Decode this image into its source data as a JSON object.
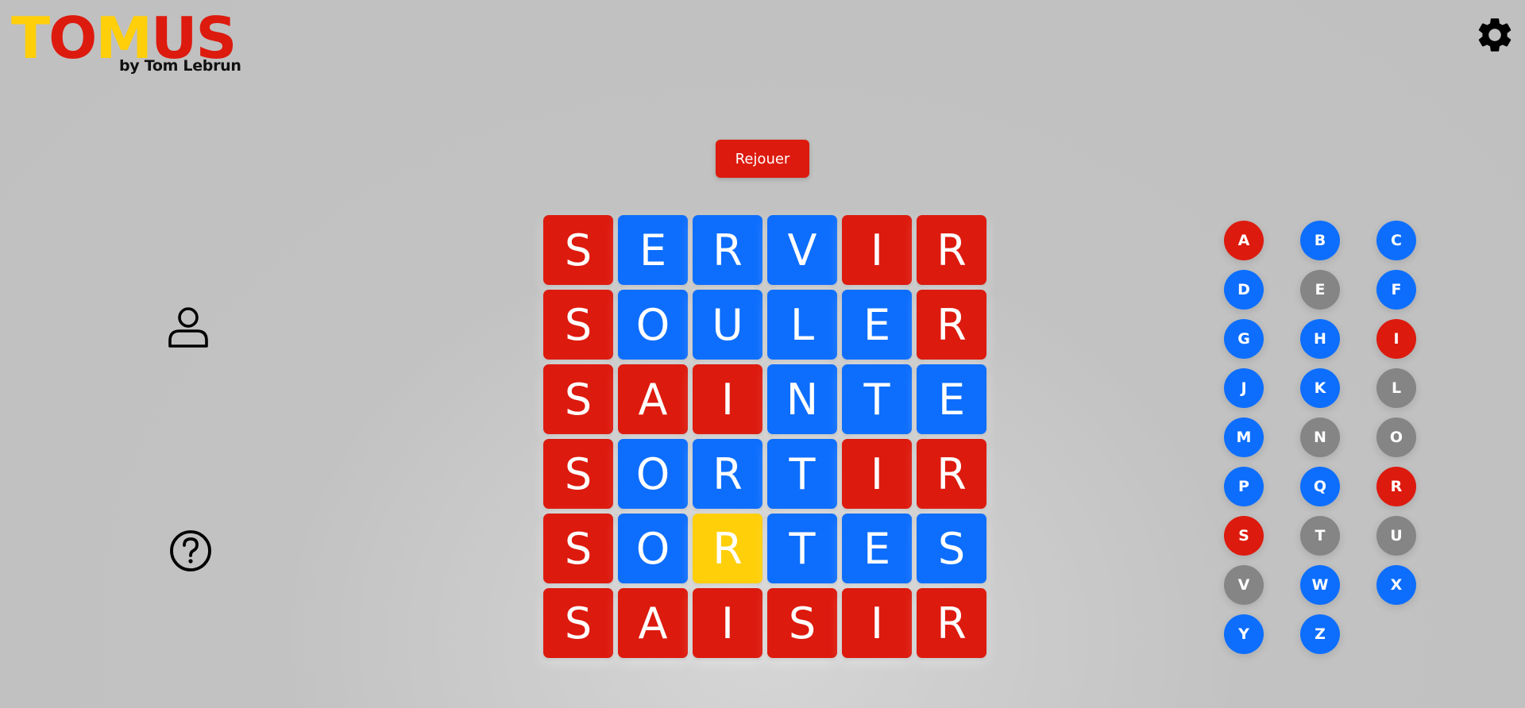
{
  "app": {
    "logo_letters": [
      {
        "char": "T",
        "color": "#ffcf0a"
      },
      {
        "char": "O",
        "color": "#dd1a0e"
      },
      {
        "char": "M",
        "color": "#ffcf0a"
      },
      {
        "char": "U",
        "color": "#dd1a0e"
      },
      {
        "char": "S",
        "color": "#dd1a0e"
      }
    ],
    "byline": "by Tom Lebrun"
  },
  "icons": {
    "settings": "gear-icon",
    "profile": "user-icon",
    "help": "help-icon"
  },
  "replay_label": "Rejouer",
  "colors": {
    "correct": "#dd1a0e",
    "misplaced": "#ffcf0a",
    "absent": "#0d6efd",
    "unused_key": "#858585"
  },
  "grid": {
    "rows": [
      [
        {
          "letter": "S",
          "state": "correct"
        },
        {
          "letter": "E",
          "state": "absent"
        },
        {
          "letter": "R",
          "state": "absent"
        },
        {
          "letter": "V",
          "state": "absent"
        },
        {
          "letter": "I",
          "state": "correct"
        },
        {
          "letter": "R",
          "state": "correct"
        }
      ],
      [
        {
          "letter": "S",
          "state": "correct"
        },
        {
          "letter": "O",
          "state": "absent"
        },
        {
          "letter": "U",
          "state": "absent"
        },
        {
          "letter": "L",
          "state": "absent"
        },
        {
          "letter": "E",
          "state": "absent"
        },
        {
          "letter": "R",
          "state": "correct"
        }
      ],
      [
        {
          "letter": "S",
          "state": "correct"
        },
        {
          "letter": "A",
          "state": "correct"
        },
        {
          "letter": "I",
          "state": "correct"
        },
        {
          "letter": "N",
          "state": "absent"
        },
        {
          "letter": "T",
          "state": "absent"
        },
        {
          "letter": "E",
          "state": "absent"
        }
      ],
      [
        {
          "letter": "S",
          "state": "correct"
        },
        {
          "letter": "O",
          "state": "absent"
        },
        {
          "letter": "R",
          "state": "absent"
        },
        {
          "letter": "T",
          "state": "absent"
        },
        {
          "letter": "I",
          "state": "correct"
        },
        {
          "letter": "R",
          "state": "correct"
        }
      ],
      [
        {
          "letter": "S",
          "state": "correct"
        },
        {
          "letter": "O",
          "state": "absent"
        },
        {
          "letter": "R",
          "state": "misplaced"
        },
        {
          "letter": "T",
          "state": "absent"
        },
        {
          "letter": "E",
          "state": "absent"
        },
        {
          "letter": "S",
          "state": "absent"
        }
      ],
      [
        {
          "letter": "S",
          "state": "correct"
        },
        {
          "letter": "A",
          "state": "correct"
        },
        {
          "letter": "I",
          "state": "correct"
        },
        {
          "letter": "S",
          "state": "correct"
        },
        {
          "letter": "I",
          "state": "correct"
        },
        {
          "letter": "R",
          "state": "correct"
        }
      ]
    ]
  },
  "keyboard": {
    "keys": [
      {
        "letter": "A",
        "state": "correct"
      },
      {
        "letter": "B",
        "state": "absent"
      },
      {
        "letter": "C",
        "state": "absent"
      },
      {
        "letter": "D",
        "state": "absent"
      },
      {
        "letter": "E",
        "state": "unused_key"
      },
      {
        "letter": "F",
        "state": "absent"
      },
      {
        "letter": "G",
        "state": "absent"
      },
      {
        "letter": "H",
        "state": "absent"
      },
      {
        "letter": "I",
        "state": "correct"
      },
      {
        "letter": "J",
        "state": "absent"
      },
      {
        "letter": "K",
        "state": "absent"
      },
      {
        "letter": "L",
        "state": "unused_key"
      },
      {
        "letter": "M",
        "state": "absent"
      },
      {
        "letter": "N",
        "state": "unused_key"
      },
      {
        "letter": "O",
        "state": "unused_key"
      },
      {
        "letter": "P",
        "state": "absent"
      },
      {
        "letter": "Q",
        "state": "absent"
      },
      {
        "letter": "R",
        "state": "correct"
      },
      {
        "letter": "S",
        "state": "correct"
      },
      {
        "letter": "T",
        "state": "unused_key"
      },
      {
        "letter": "U",
        "state": "unused_key"
      },
      {
        "letter": "V",
        "state": "unused_key"
      },
      {
        "letter": "W",
        "state": "absent"
      },
      {
        "letter": "X",
        "state": "absent"
      },
      {
        "letter": "Y",
        "state": "absent"
      },
      {
        "letter": "Z",
        "state": "absent"
      }
    ]
  }
}
